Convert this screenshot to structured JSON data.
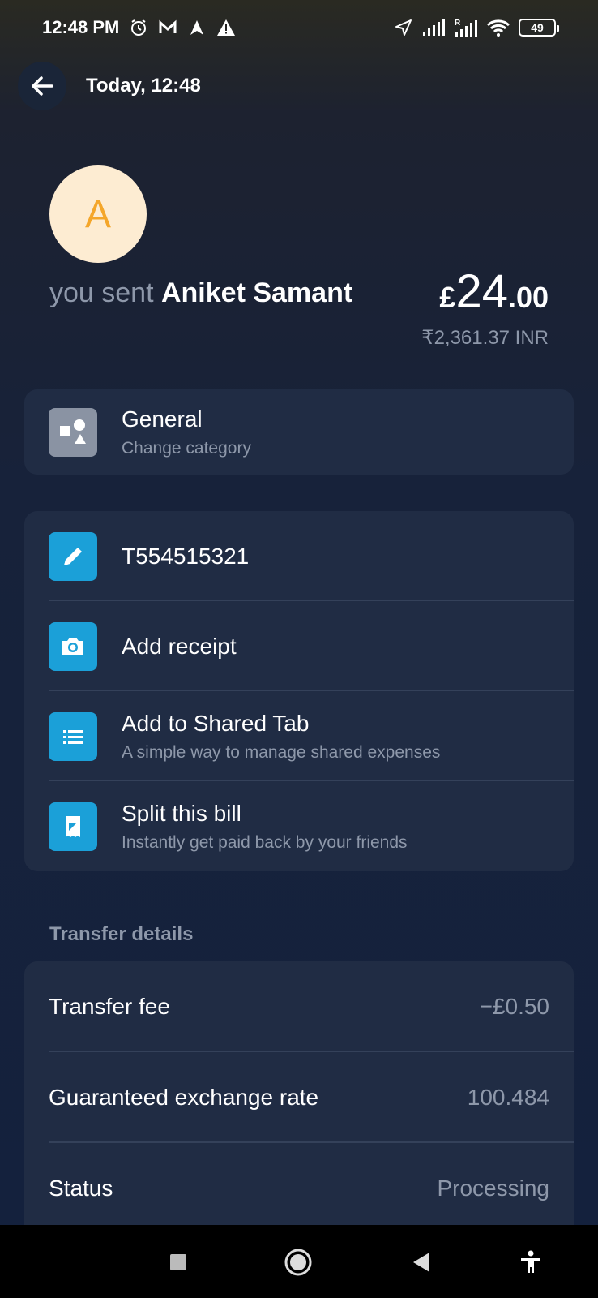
{
  "status_bar": {
    "time": "12:48 PM",
    "battery": "49",
    "left_icons": [
      "alarm-icon",
      "m-icon",
      "arrow-up-icon",
      "warning-icon"
    ],
    "right_icons": [
      "location-icon",
      "signal-icon",
      "signal-roaming-icon",
      "wifi-icon",
      "battery-icon"
    ]
  },
  "header": {
    "title": "Today, 12:48",
    "back_icon": "arrow-left-icon"
  },
  "recipient": {
    "avatar_letter": "A",
    "prefix": "you sent ",
    "name": "Aniket Samant"
  },
  "amount": {
    "currency_symbol": "£",
    "whole": "24",
    "decimal": ".00",
    "converted": "₹2,361.37 INR"
  },
  "category": {
    "title": "General",
    "subtitle": "Change category",
    "icon": "shapes-icon"
  },
  "actions": [
    {
      "title": "T554515321",
      "subtitle": "",
      "icon": "pencil-icon"
    },
    {
      "title": "Add receipt",
      "subtitle": "",
      "icon": "camera-icon"
    },
    {
      "title": "Add to Shared Tab",
      "subtitle": "A simple way to manage shared expenses",
      "icon": "list-icon"
    },
    {
      "title": "Split this bill",
      "subtitle": "Instantly get paid back by your friends",
      "icon": "receipt-icon"
    }
  ],
  "transfer_details": {
    "title": "Transfer details",
    "rows": [
      {
        "label": "Transfer fee",
        "value": "−£0.50"
      },
      {
        "label": "Guaranteed exchange rate",
        "value": "100.484"
      },
      {
        "label": "Status",
        "value": "Processing"
      }
    ]
  },
  "colors": {
    "accent": "#1ba0d8",
    "card": "#202c44",
    "avatar_bg": "#fdecd2",
    "avatar_fg": "#f4a62a",
    "muted_text": "#8e98aa"
  }
}
